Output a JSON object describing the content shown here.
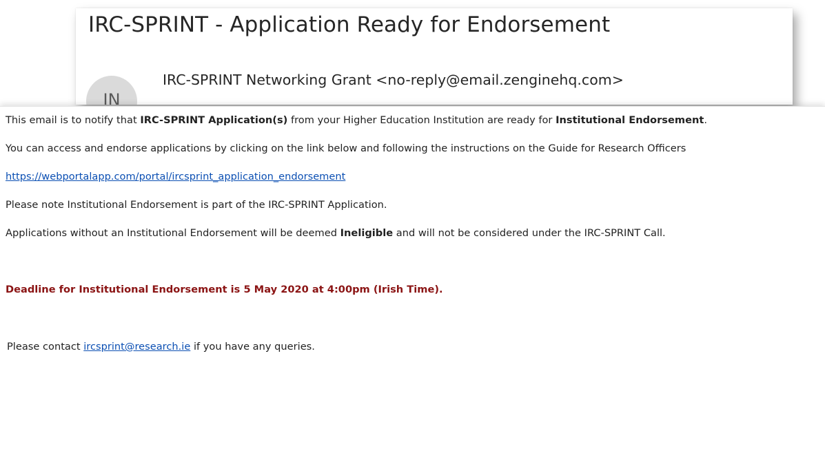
{
  "email": {
    "subject": "IRC-SPRINT - Application Ready for Endorsement",
    "avatar_initials": "IN",
    "sender": "IRC-SPRINT Networking Grant <no-reply@email.zenginehq.com>"
  },
  "body": {
    "p1": {
      "t1": "This email is to notify that ",
      "b1": "IRC-SPRINT Application(s)",
      "t2": " from your Higher Education Institution are ready for ",
      "b2": "Institutional Endorsement",
      "t3": "."
    },
    "p2": "You can access and endorse applications by clicking on the link below and following the instructions on the Guide for Research Officers",
    "link": "https://webportalapp.com/portal/ircsprint_application_endorsement",
    "p3": "Please note Institutional Endorsement is part of the IRC-SPRINT Application.",
    "p4": {
      "t1": "Applications without an Institutional Endorsement will be deemed ",
      "b1": "Ineligible",
      "t2": " and will not be considered under the IRC-SPRINT Call."
    },
    "deadline": "Deadline for Institutional Endorsement is 5 May 2020 at 4:00pm (Irish Time).",
    "contact": {
      "t1": "Please contact ",
      "email": "ircsprint@research.ie",
      "t2": " if you have any queries."
    }
  },
  "colors": {
    "deadline": "#8b1414",
    "link": "#0b4fb3",
    "avatar_bg": "#dadada"
  }
}
